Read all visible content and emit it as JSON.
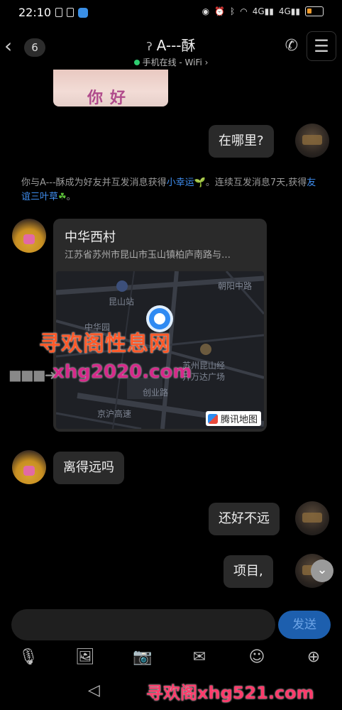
{
  "status_bar": {
    "time": "22:10",
    "network": "4G",
    "network2": "4G",
    "colors": {
      "battery": "#f39c2b"
    }
  },
  "header": {
    "unread_count": "6",
    "contact_name": "A---酥",
    "online_status": "手机在线 - WiFi ›",
    "icons": [
      "back-icon",
      "ear-icon",
      "phone-icon",
      "menu-icon"
    ]
  },
  "messages": {
    "image_caption": "你好",
    "msg_where": "在哪里?",
    "system_text_1": "你与A---酥成为好友并互发消息获得",
    "system_link_1": "小幸运",
    "system_text_2": "。连续互发消息7天,获得",
    "system_link_2": "友谊三叶草",
    "system_text_3": "。",
    "location": {
      "name": "中华西村",
      "address": "江苏省苏州市昆山市玉山镇柏庐南路与…",
      "map_labels": {
        "station": "昆山站",
        "road_1": "朝阳中路",
        "road_2": "中华园",
        "road_3": "创业路",
        "road_4": "京沪高速",
        "poi": "苏州昆山经",
        "poi_2": "开万达广场"
      },
      "map_brand": "腾讯地图"
    },
    "msg_far": "离得远吗",
    "msg_ok": "还好不远",
    "msg_project": "项目,"
  },
  "watermark": {
    "main": "寻欢阁性息网",
    "url": "xhg2020.com",
    "bottom": "寻欢阁xhg521.com"
  },
  "composer": {
    "send_label": "发送",
    "tools": [
      "microphone-icon",
      "image-icon",
      "camera-icon",
      "red-packet-icon",
      "emoji-icon",
      "plus-icon"
    ]
  }
}
